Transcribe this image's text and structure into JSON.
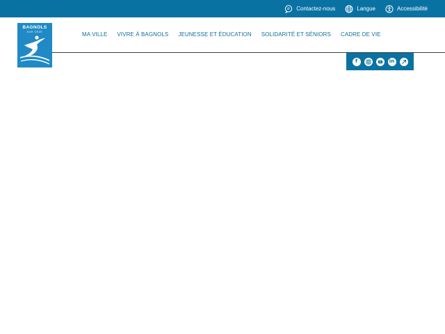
{
  "topbar": {
    "links": [
      {
        "label": "Contactez-nous",
        "icon": "chat-icon"
      },
      {
        "label": "Langue",
        "icon": "globe-icon"
      },
      {
        "label": "Accessibilité",
        "icon": "accessibility-icon"
      }
    ]
  },
  "logo": {
    "top_text": "BAGNOLS",
    "sub_text": "SUR CÈZE"
  },
  "nav": {
    "items": [
      "MA VILLE",
      "VIVRE À BAGNOLS",
      "JEUNESSE ET ÉDUCATION",
      "SOLIDARITÉ ET SÉNIORS",
      "CADRE DE VIE"
    ]
  },
  "social": {
    "icons": [
      "facebook-icon",
      "instagram-icon",
      "youtube-icon",
      "linkedin-icon",
      "app-icon"
    ],
    "glyphs": [
      "f",
      "",
      "",
      "in",
      ""
    ]
  },
  "colors": {
    "primary": "#0a72a3",
    "logo_bg": "#1f8ac5",
    "nav_text": "#146d97",
    "rule": "#3f3f3f"
  }
}
